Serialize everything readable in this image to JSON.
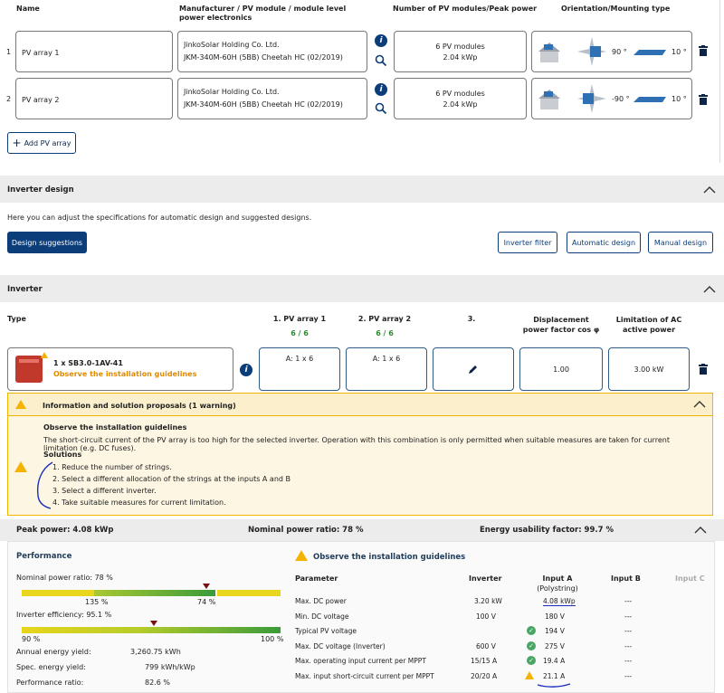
{
  "pv_table": {
    "headers": {
      "name": "Name",
      "manufacturer": "Manufacturer / PV module / module level power electronics",
      "number": "Number of PV modules/Peak power",
      "orientation": "Orientation/Mounting type"
    },
    "rows": [
      {
        "index": "1",
        "name": "PV array 1",
        "manufacturer": "JinkoSolar Holding Co. Ltd.",
        "module": "JKM-340M-60H (5BB) Cheetah HC (02/2019)",
        "modules": "6 PV modules",
        "peak": "2.04 kWp",
        "azimuth": "90 °",
        "tilt": "10 °"
      },
      {
        "index": "2",
        "name": "PV array 2",
        "manufacturer": "JinkoSolar Holding Co. Ltd.",
        "module": "JKM-340M-60H (5BB) Cheetah HC (02/2019)",
        "modules": "6 PV modules",
        "peak": "2.04 kWp",
        "azimuth": "-90 °",
        "tilt": "10 °"
      }
    ],
    "add_label": "Add PV array"
  },
  "inverter_design": {
    "title": "Inverter design",
    "description": "Here you can adjust the specifications for automatic design and suggested designs.",
    "suggestions_label": "Design suggestions",
    "filter_label": "Inverter filter",
    "automatic_label": "Automatic design",
    "manual_label": "Manual design"
  },
  "inverter": {
    "title": "Inverter",
    "headers": {
      "type": "Type",
      "pv1": "1. PV array 1",
      "pv1_count": "6 / 6",
      "pv2": "2. PV array 2",
      "pv2_count": "6 / 6",
      "col3": "3.",
      "displacement": "Displacement power factor cos φ",
      "limitation": "Limitation of AC active power"
    },
    "model": "1 x SB3.0-1AV-41",
    "model_warning": "Observe the installation guidelines",
    "pv1_assign": "A: 1 x 6",
    "pv2_assign": "A: 1 x 6",
    "cos_phi": "1.00",
    "ac_limit": "3.00 kW"
  },
  "info": {
    "title": "Information and solution proposals (1 warning)",
    "heading": "Observe the installation guidelines",
    "text": "The short-circuit current of the PV array is too high for the selected inverter. Operation with this combination is only permitted when suitable measures are taken for current limitation (e.g. DC fuses).",
    "solutions_title": "Solutions",
    "solutions": [
      "1. Reduce the number of strings.",
      "2. Select a different allocation of the strings at the inputs A and B",
      "3. Select a different inverter.",
      "4. Take suitable measures for current limitation."
    ]
  },
  "summary": {
    "peak_power": "Peak power: 4.08 kWp",
    "nominal_ratio": "Nominal power ratio: 78 %",
    "energy_usability": "Energy usability factor: 99.7 %"
  },
  "performance": {
    "title": "Performance",
    "nominal_label": "Nominal power ratio: 78 %",
    "nominal_value": 78,
    "nominal_marker_label": "74 %",
    "nominal_left_label": "135 %",
    "efficiency_label": "Inverter efficiency: 95.1 %",
    "efficiency_value": 95.1,
    "eff_min": "90 %",
    "eff_max": "100 %",
    "annual_label": "Annual energy yield:",
    "annual_value": "3,260.75 kWh",
    "specific_label": "Spec. energy yield:",
    "specific_value": "799 kWh/kWp",
    "ratio_label": "Performance ratio:",
    "ratio_value": "82.6 %"
  },
  "guidelines": {
    "title": "Observe the installation guidelines",
    "headers": {
      "param": "Parameter",
      "inverter": "Inverter",
      "input_a": "Input A",
      "input_a_sub": "(Polystring)",
      "input_b": "Input B",
      "input_c": "Input C"
    },
    "rows": [
      {
        "param": "Max. DC power",
        "inverter": "3.20 kW",
        "status": "",
        "a": "4.08 kWp",
        "b": "---"
      },
      {
        "param": "Min. DC voltage",
        "inverter": "100 V",
        "status": "",
        "a": "180 V",
        "b": "---"
      },
      {
        "param": "Typical PV voltage",
        "inverter": "",
        "status": "ok",
        "a": "194 V",
        "b": "---"
      },
      {
        "param": "Max. DC voltage (Inverter)",
        "inverter": "600 V",
        "status": "ok",
        "a": "275 V",
        "b": "---"
      },
      {
        "param": "Max. operating input current per MPPT",
        "inverter": "15/15 A",
        "status": "ok",
        "a": "19.4 A",
        "b": "---"
      },
      {
        "param": "Max. input short-circuit current per MPPT",
        "inverter": "20/20 A",
        "status": "warn",
        "a": "21.1 A",
        "b": "---"
      }
    ]
  },
  "colors": {
    "primary": "#0b3d7a",
    "warning": "#f5b301",
    "ok": "#4aa564",
    "danger": "#c0392b",
    "warning_bg": "#fdf6e3"
  }
}
